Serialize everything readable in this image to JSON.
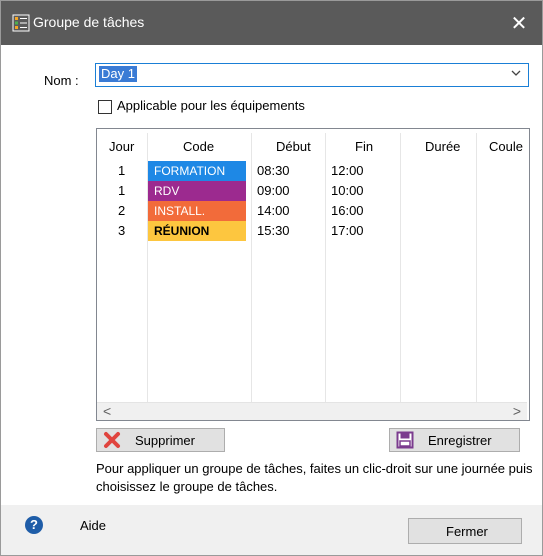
{
  "window": {
    "title": "Groupe de tâches",
    "close_glyph": "✕",
    "icon": "task-list-icon"
  },
  "form": {
    "name_label": "Nom :",
    "name_value": "Day 1",
    "dropdown_glyph": "⌄",
    "checkbox_label": "Applicable pour les équipements",
    "checkbox_checked": false
  },
  "table": {
    "columns": [
      "Jour",
      "Code",
      "Début",
      "Fin",
      "Durée",
      "Coule"
    ],
    "rows": [
      {
        "jour": "1",
        "code": "FORMATION",
        "debut": "08:30",
        "fin": "12:00",
        "duree": "",
        "color": "#1e88e5",
        "text_color": "#ffffff",
        "bold": false
      },
      {
        "jour": "1",
        "code": "RDV",
        "debut": "09:00",
        "fin": "10:00",
        "duree": "",
        "color": "#9c2a8f",
        "text_color": "#ffffff",
        "bold": false
      },
      {
        "jour": "2",
        "code": "INSTALL.",
        "debut": "14:00",
        "fin": "16:00",
        "duree": "",
        "color": "#f26b3a",
        "text_color": "#ffffff",
        "bold": false
      },
      {
        "jour": "3",
        "code": "RÉUNION",
        "debut": "15:30",
        "fin": "17:00",
        "duree": "",
        "color": "#fdc63f",
        "text_color": "#000000",
        "bold": true
      }
    ],
    "scroll_left": "<",
    "scroll_right": ">"
  },
  "buttons": {
    "delete_label": "Supprimer",
    "save_label": "Enregistrer",
    "close_label": "Fermer"
  },
  "note": "Pour appliquer un groupe de tâches, faites un clic-droit sur une journée puis choisissez le groupe de tâches.",
  "footer": {
    "help_glyph": "?",
    "help_label": "Aide"
  },
  "colors": {
    "titlebar": "#5a5a5a",
    "selection": "#3a7bd5",
    "delete_icon": "#e0443e",
    "save_icon": "#7b3b8e",
    "help_icon": "#1f5da8"
  }
}
